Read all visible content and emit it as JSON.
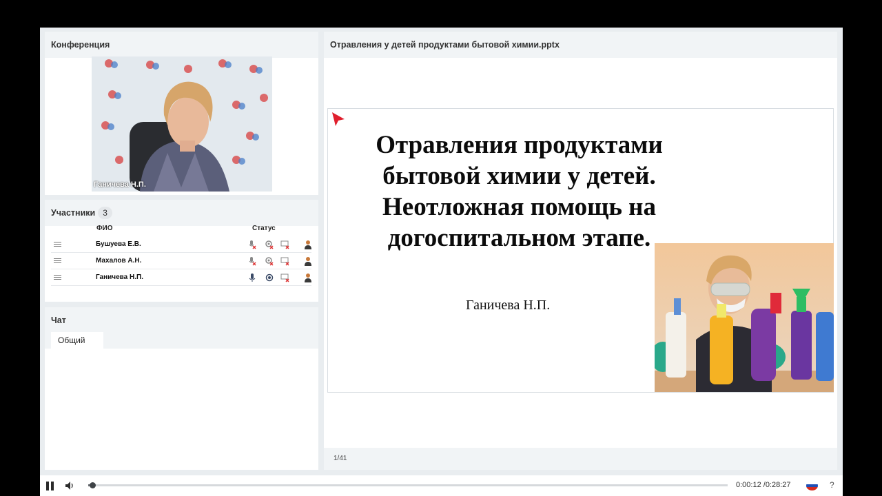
{
  "conference": {
    "title": "Конференция",
    "speaker_label": "Ганичева Н.П."
  },
  "participants": {
    "title": "Участники",
    "count": "3",
    "columns": {
      "name": "ФИО",
      "status": "Статус"
    },
    "rows": [
      {
        "name": "Бушуева Е.В.",
        "mic": "off",
        "cam": "off",
        "screen": "off"
      },
      {
        "name": "Махалов А.Н.",
        "mic": "off",
        "cam": "off",
        "screen": "off"
      },
      {
        "name": "Ганичева Н.П.",
        "mic": "on",
        "cam": "on",
        "screen": "off"
      }
    ]
  },
  "chat": {
    "title": "Чат",
    "tab": "Общий"
  },
  "presentation": {
    "filename": "Отравления у детей продуктами бытовой химии.pptx",
    "slide_title": "Отравления продуктами\nбытовой химии у детей.\nНеотложная помощь на\nдогоспитальном этапе.",
    "slide_author": "Ганичева Н.П.",
    "page": "1/41"
  },
  "player": {
    "time": "0:00:12 /0:28:27",
    "progress": 0.007,
    "help": "?",
    "accent": "#6c7075"
  }
}
